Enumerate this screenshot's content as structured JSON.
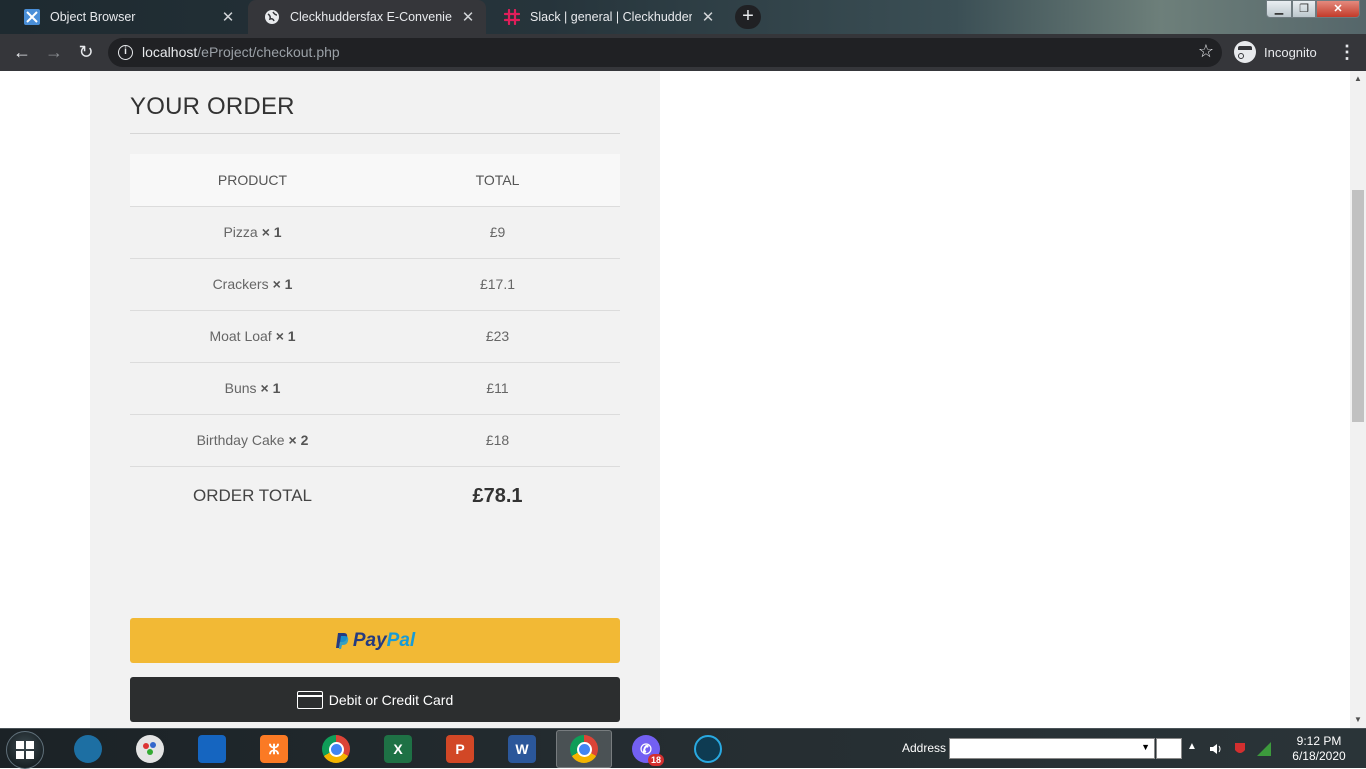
{
  "browser": {
    "tabs": [
      {
        "label": "Object Browser",
        "icon": "object-browser-icon",
        "active": false
      },
      {
        "label": "Cleckhuddersfax E-Convenient St",
        "icon": "globe-icon",
        "active": true
      },
      {
        "label": "Slack | general | Cleckhuddersfax",
        "icon": "slack-icon",
        "active": false
      }
    ],
    "url_host": "localhost",
    "url_path": "/eProject/checkout.php",
    "incognito_label": "Incognito"
  },
  "order": {
    "title": "YOUR ORDER",
    "headers": {
      "product": "PRODUCT",
      "total": "TOTAL"
    },
    "items": [
      {
        "name": "Pizza",
        "qty": "× 1",
        "total": "£9"
      },
      {
        "name": "Crackers",
        "qty": "× 1",
        "total": "£17.1"
      },
      {
        "name": "Moat Loaf",
        "qty": "× 1",
        "total": "£23"
      },
      {
        "name": "Buns",
        "qty": "× 1",
        "total": "£11"
      },
      {
        "name": "Birthday Cake",
        "qty": "× 2",
        "total": "£18"
      }
    ],
    "total_label": "ORDER TOTAL",
    "total_value": "£78.1"
  },
  "payment": {
    "paypal_pay": "Pay",
    "paypal_pal": "Pal",
    "card_label": "Debit or Credit Card",
    "colors": {
      "paypal_bg": "#f2b935",
      "card_bg": "#2c2e2f"
    }
  },
  "taskbar": {
    "address_label": "Address",
    "time": "9:12 PM",
    "date": "6/18/2020",
    "viber_badge": "18",
    "apps": [
      "explorer-icon",
      "paint-icon",
      "virtualbox-icon",
      "xampp-icon",
      "chrome-icon",
      "excel-icon",
      "powerpoint-icon",
      "word-icon",
      "chrome-icon",
      "viber-icon",
      "eye-app-icon"
    ]
  }
}
